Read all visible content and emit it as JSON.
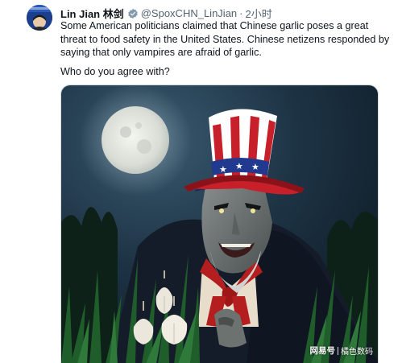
{
  "author": {
    "display_name": "Lin Jian 林剑",
    "handle": "@SpoxCHN_LinJian",
    "separator": "·",
    "time": "2小时",
    "verified_icon": "verified-badge-icon",
    "verified_color": "#829aab"
  },
  "tweet": {
    "text": "Some American politicians claimed that Chinese garlic poses a great threat to food safety in the United States. Chinese netizens responded by saying that only vampires are afraid of garlic.",
    "question": "Who do you agree with?"
  },
  "watermark": {
    "logo": "网易号",
    "source": "橘色数码"
  },
  "colors": {
    "text": "#0f1419",
    "secondary": "#536471",
    "border": "#cfd9de"
  }
}
